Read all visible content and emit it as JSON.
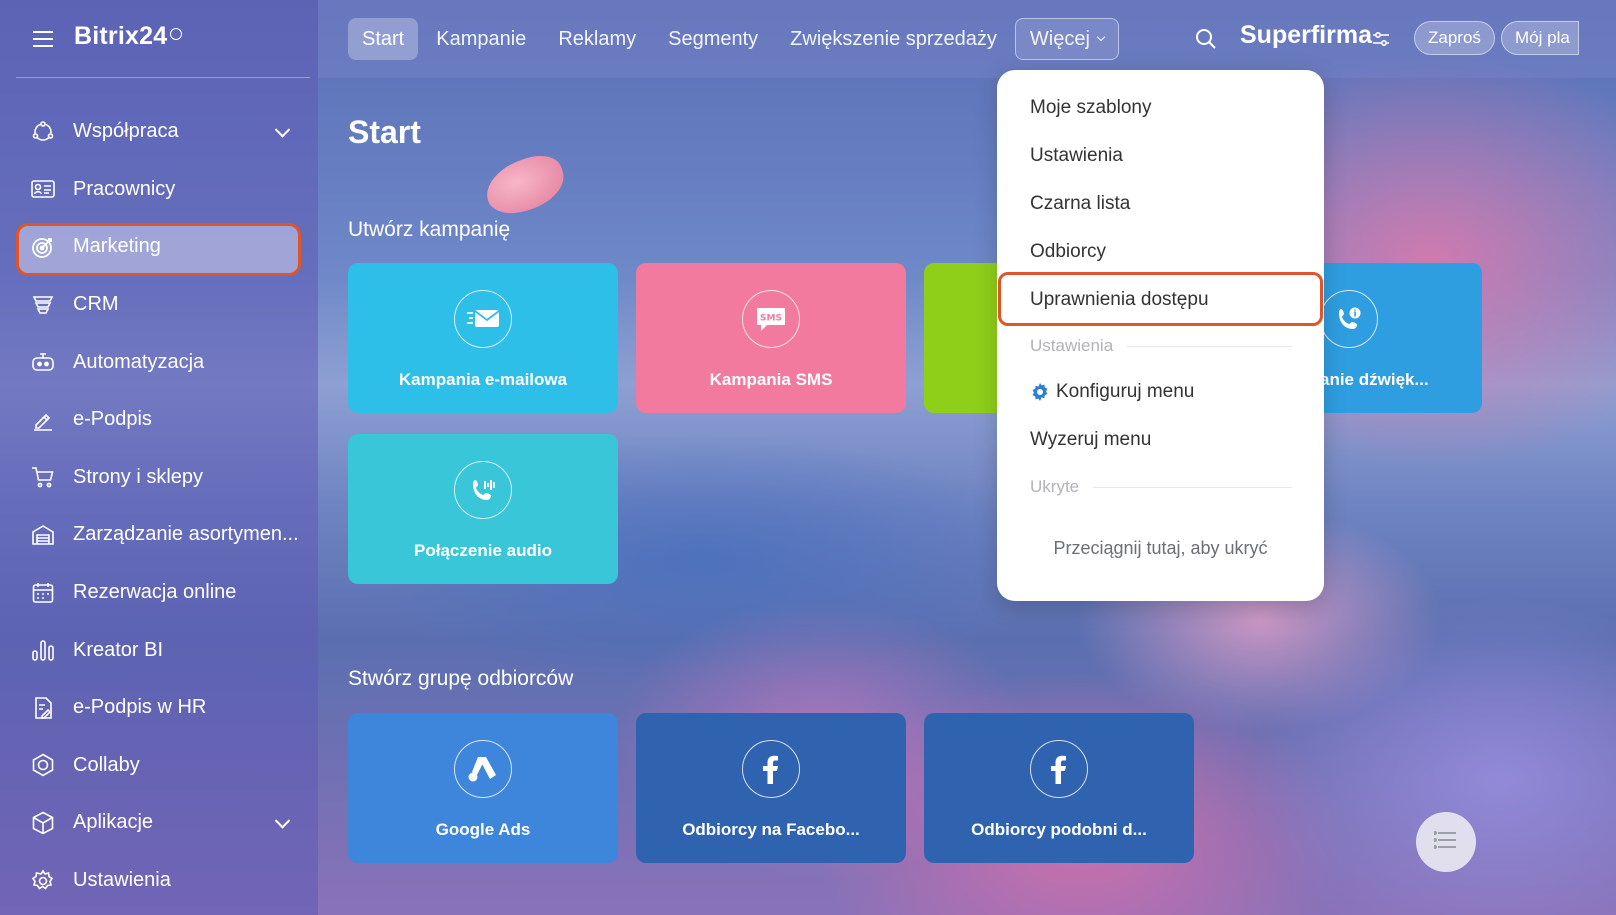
{
  "sidebar": {
    "brand": "Bitrix24",
    "items": [
      {
        "label": "Współpraca",
        "icon": "collab-icon",
        "has_chevron": true
      },
      {
        "label": "Pracownicy",
        "icon": "employees-icon"
      },
      {
        "label": "Marketing",
        "icon": "marketing-icon",
        "active": true
      },
      {
        "label": "CRM",
        "icon": "crm-icon"
      },
      {
        "label": "Automatyzacja",
        "icon": "automation-icon"
      },
      {
        "label": "e-Podpis",
        "icon": "e-signature-icon"
      },
      {
        "label": "Strony i sklepy",
        "icon": "cart-icon"
      },
      {
        "label": "Zarządzanie asortymen...",
        "icon": "warehouse-icon"
      },
      {
        "label": "Rezerwacja online",
        "icon": "calendar-icon"
      },
      {
        "label": "Kreator BI",
        "icon": "bi-chart-icon"
      },
      {
        "label": "e-Podpis w HR",
        "icon": "hr-signature-icon"
      },
      {
        "label": "Collaby",
        "icon": "collaby-icon"
      },
      {
        "label": "Aplikacje",
        "icon": "apps-icon",
        "has_chevron": true
      },
      {
        "label": "Ustawienia",
        "icon": "settings-icon"
      }
    ]
  },
  "topbar": {
    "tabs": [
      {
        "label": "Start",
        "active": true
      },
      {
        "label": "Kampanie"
      },
      {
        "label": "Reklamy"
      },
      {
        "label": "Segmenty"
      },
      {
        "label": "Zwiększenie sprzedaży"
      }
    ],
    "more_label": "Więcej",
    "company": "Superfirma",
    "invite_label": "Zaproś",
    "my_plan_label": "Mój pla"
  },
  "main": {
    "title": "Start",
    "create_campaign_title": "Utwórz kampanię",
    "create_group_title": "Stwórz grupę odbiorców",
    "campaign_tiles": [
      {
        "label": "Kampania e-mailowa",
        "icon": "email-icon",
        "color": "#2ebfe8"
      },
      {
        "label": "Kampania SMS",
        "icon": "sms-icon",
        "color": "#f17a9e"
      },
      {
        "label": "",
        "icon": "",
        "color": "#8fcf1a"
      },
      {
        "label": "anie dźwięk...",
        "icon": "phone-info-icon",
        "color": "#2f9ee0"
      },
      {
        "label": "Połączenie audio",
        "icon": "audio-call-icon",
        "color": "#38c6d8"
      }
    ],
    "group_tiles": [
      {
        "label": "Google Ads",
        "icon": "google-ads-icon",
        "color": "#3d86dc"
      },
      {
        "label": "Odbiorcy na Facebo...",
        "icon": "facebook-icon",
        "color": "#2f63b0"
      },
      {
        "label": "Odbiorcy podobni d...",
        "icon": "facebook-icon",
        "color": "#2f63b0"
      }
    ]
  },
  "dropdown": {
    "items": [
      "Moje szablony",
      "Ustawienia",
      "Czarna lista",
      "Odbiorcy",
      "Uprawnienia dostępu"
    ],
    "settings_section": "Ustawienia",
    "configure_label": "Konfiguruj menu",
    "reset_label": "Wyzeruj menu",
    "hidden_section": "Ukryte",
    "drag_hint": "Przeciągnij tutaj, aby ukryć"
  },
  "colors": {
    "highlight": "#e0542a",
    "gear": "#2d7fd6"
  }
}
